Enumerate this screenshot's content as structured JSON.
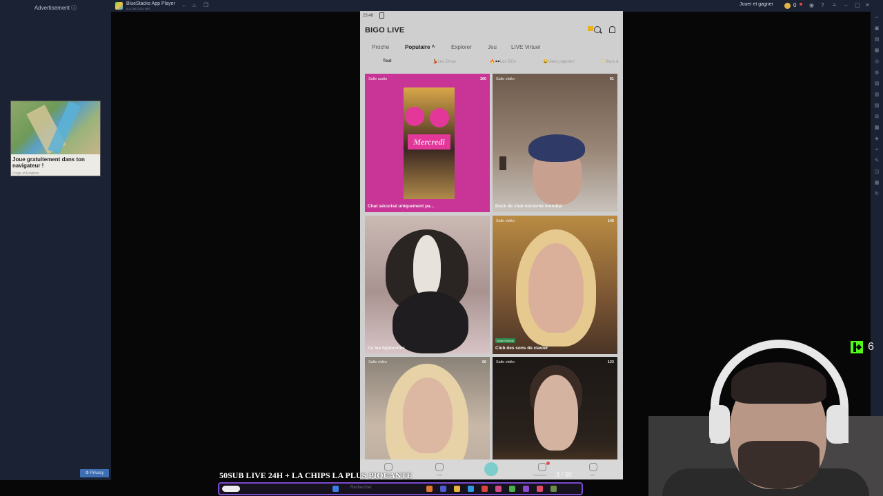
{
  "ad": {
    "header": "Advertisement ⓘ",
    "card_text": "Joue gratuitement dans ton navigateur !",
    "card_sub": "Forge of Empires",
    "privacy_label": "⚙ Privacy"
  },
  "bluestacks": {
    "name": "BlueStacks App Player",
    "version": "5.21.580.1024 N64",
    "jouer_label": "Jouer et gagner",
    "coins": "0"
  },
  "phone": {
    "status_time": "23:48",
    "app_name": "BIGO LIVE",
    "tabs": [
      {
        "label": "Proche",
        "active": false
      },
      {
        "label": "Populaire ^",
        "active": true
      },
      {
        "label": "Explorer",
        "active": false
      },
      {
        "label": "Jeu",
        "active": false
      },
      {
        "label": "LIVE Virtuel",
        "active": false
      }
    ],
    "subtabs": [
      {
        "label": "Tout",
        "active": true
      },
      {
        "label": "💃Les Divas",
        "active": false
      },
      {
        "label": "🔥🕶️Les BGs",
        "active": false
      },
      {
        "label": "😀Viens papoter!",
        "active": false
      },
      {
        "label": "✨Stars d",
        "active": false
      }
    ],
    "cards": [
      {
        "type": "Salle audio",
        "count": "160",
        "title": "Chat sécurisé uniquement pa...",
        "overlay": "Mercredi"
      },
      {
        "type": "Salle vidéo",
        "count": "91",
        "title": "Dock de chat nocturne mondial"
      },
      {
        "type": "",
        "count": "",
        "title": "Cc les hypocrites"
      },
      {
        "type": "Salle vidéo",
        "count": "145",
        "title": "Club des sons de clavier",
        "badge": "Seule Femme"
      },
      {
        "type": "Salle vidéo",
        "count": "66",
        "title": ""
      },
      {
        "type": "Salle vidéo",
        "count": "123",
        "title": ""
      }
    ],
    "nav": [
      {
        "label": "Live"
      },
      {
        "label": "Fête"
      },
      {
        "label": ""
      },
      {
        "label": "Discussion"
      },
      {
        "label": "Moi"
      }
    ]
  },
  "stream": {
    "title": "50SUB LIVE 24H + LA CHIPS LA PLUS PIQUANTE",
    "sub_counter": "3 / 50",
    "kick_count": "6"
  },
  "taskbar": {
    "search_placeholder": "Rechercher"
  },
  "colors": {
    "kick_green": "#53fc18",
    "taskbar_border": "#7a4ad0",
    "card_audio_bg": "#d63aa0"
  }
}
